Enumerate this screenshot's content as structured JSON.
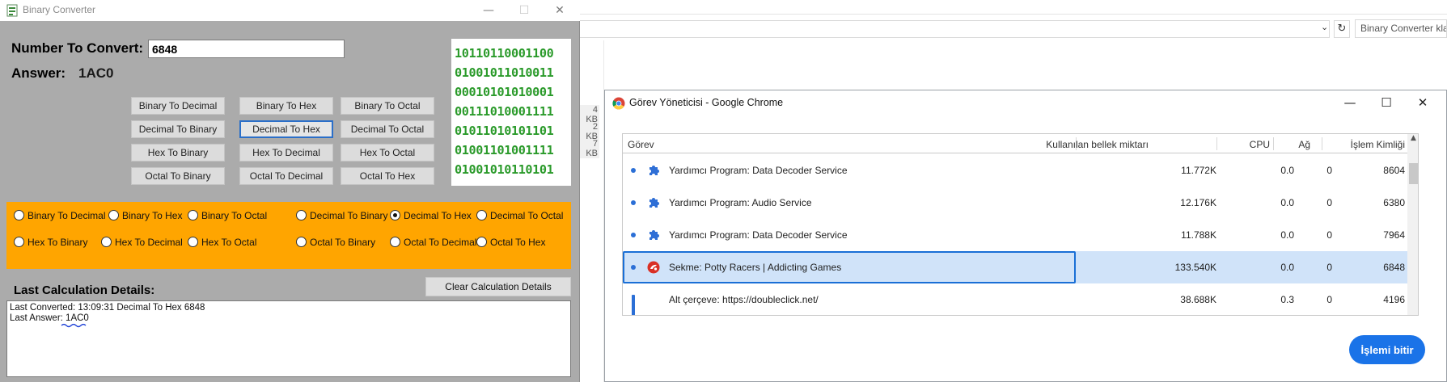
{
  "background": {
    "search_placeholder": "Binary Converter kla",
    "sizes": [
      "4 KB",
      "2 KB",
      "7 KB"
    ]
  },
  "converter": {
    "title": "Binary Converter",
    "number_label": "Number To Convert:",
    "number_value": "6848",
    "answer_label": "Answer:",
    "answer_value": "1AC0",
    "binary_lines": [
      "10110110001100",
      "01001011010011",
      "00010101010001",
      "00111010001111",
      "01011010101101",
      "01001101001111",
      "01001010110101"
    ],
    "buttons": [
      [
        "Binary To Decimal",
        "Binary To Hex",
        "Binary To Octal"
      ],
      [
        "Decimal To Binary",
        "Decimal To Hex",
        "Decimal To Octal"
      ],
      [
        "Hex To Binary",
        "Hex To Decimal",
        "Hex To Octal"
      ],
      [
        "Octal To Binary",
        "Octal To Decimal",
        "Octal To Hex"
      ]
    ],
    "active_button": "Decimal To Hex",
    "radios": [
      [
        "Binary To Decimal",
        "Binary To Hex",
        "Binary To Octal",
        "Decimal To Binary",
        "Decimal To Hex",
        "Decimal To Octal"
      ],
      [
        "Hex To Binary",
        "Hex To Decimal",
        "Hex To Octal",
        "Octal To Binary",
        "Octal To Decimal",
        "Octal To Hex"
      ]
    ],
    "selected_radio": "Decimal To Hex",
    "last_title": "Last Calculation Details:",
    "clear_label": "Clear Calculation Details",
    "last_converted": "Last Converted: 13:09:31  Decimal To Hex 6848",
    "last_answer_prefix": "Last Answer: ",
    "last_answer_value": "1AC0",
    "colors": {
      "panel": "#ffa500",
      "binary_text": "#2a9a2a",
      "window": "#ababab"
    }
  },
  "task_manager": {
    "title": "Görev Yöneticisi - Google Chrome",
    "columns": [
      "Görev",
      "Kullanılan bellek miktarı",
      "CPU",
      "Ağ",
      "İşlem Kimliği"
    ],
    "rows": [
      {
        "icon": "puzzle-icon",
        "task": "Yardımcı Program: Data Decoder Service",
        "memory": "11.772K",
        "cpu": "0.0",
        "net": "0",
        "pid": "8604"
      },
      {
        "icon": "puzzle-icon",
        "task": "Yardımcı Program: Audio Service",
        "memory": "12.176K",
        "cpu": "0.0",
        "net": "0",
        "pid": "6380"
      },
      {
        "icon": "puzzle-icon",
        "task": "Yardımcı Program: Data Decoder Service",
        "memory": "11.788K",
        "cpu": "0.0",
        "net": "0",
        "pid": "7964"
      },
      {
        "icon": "game-icon",
        "task": "Sekme: Potty Racers | Addicting Games",
        "memory": "133.540K",
        "cpu": "0.0",
        "net": "0",
        "pid": "6848"
      },
      {
        "icon": "frame-icon",
        "task": "Alt çerçeve: https://doubleclick.net/",
        "memory": "38.688K",
        "cpu": "0.3",
        "net": "0",
        "pid": "4196"
      }
    ],
    "selected_row": 3,
    "end_button": "İşlemi bitir",
    "colors": {
      "accent": "#1a73e8",
      "selection": "#d0e3f9"
    }
  }
}
